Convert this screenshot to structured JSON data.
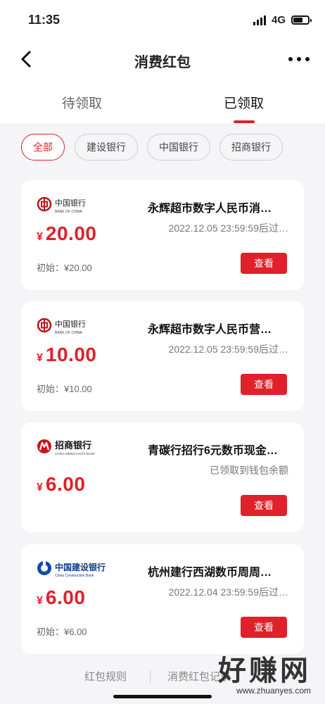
{
  "status": {
    "time": "11:35",
    "network": "4G"
  },
  "header": {
    "title": "消费红包"
  },
  "tabs": [
    {
      "label": "待领取"
    },
    {
      "label": "已领取"
    }
  ],
  "filters": [
    {
      "label": "全部"
    },
    {
      "label": "建设银行"
    },
    {
      "label": "中国银行"
    },
    {
      "label": "招商银行"
    }
  ],
  "colors": {
    "accent": "#e0202a"
  },
  "cards": [
    {
      "bank": "中国银行",
      "bank_en": "BANK OF CHINA",
      "title": "永辉超市数字人民币消…",
      "subtitle": "2022.12.05 23:59:59后过…",
      "currency": "¥",
      "amount": "20.00",
      "initial": "初始：¥20.00",
      "button": "查看"
    },
    {
      "bank": "中国银行",
      "bank_en": "BANK OF CHINA",
      "title": "永辉超市数字人民币营…",
      "subtitle": "2022.12.05 23:59:59后过…",
      "currency": "¥",
      "amount": "10.00",
      "initial": "初始：¥10.00",
      "button": "查看"
    },
    {
      "bank": "招商银行",
      "bank_en": "CHINA MERCHANTS BANK",
      "title": "青碳行招行6元数币现金…",
      "subtitle": "已领取到钱包余额",
      "currency": "¥",
      "amount": "6.00",
      "button": "查看"
    },
    {
      "bank": "中国建设银行",
      "bank_en": "China Construction Bank",
      "title": "杭州建行西湖数币周周…",
      "subtitle": "2022.12.04 23:59:59后过…",
      "currency": "¥",
      "amount": "6.00",
      "initial": "初始：¥6.00",
      "button": "查看"
    }
  ],
  "footer": {
    "rules": "红包规则",
    "records": "消费红包记录"
  },
  "watermark": {
    "text": "好赚网",
    "url": "www.zhuanyes.com"
  }
}
